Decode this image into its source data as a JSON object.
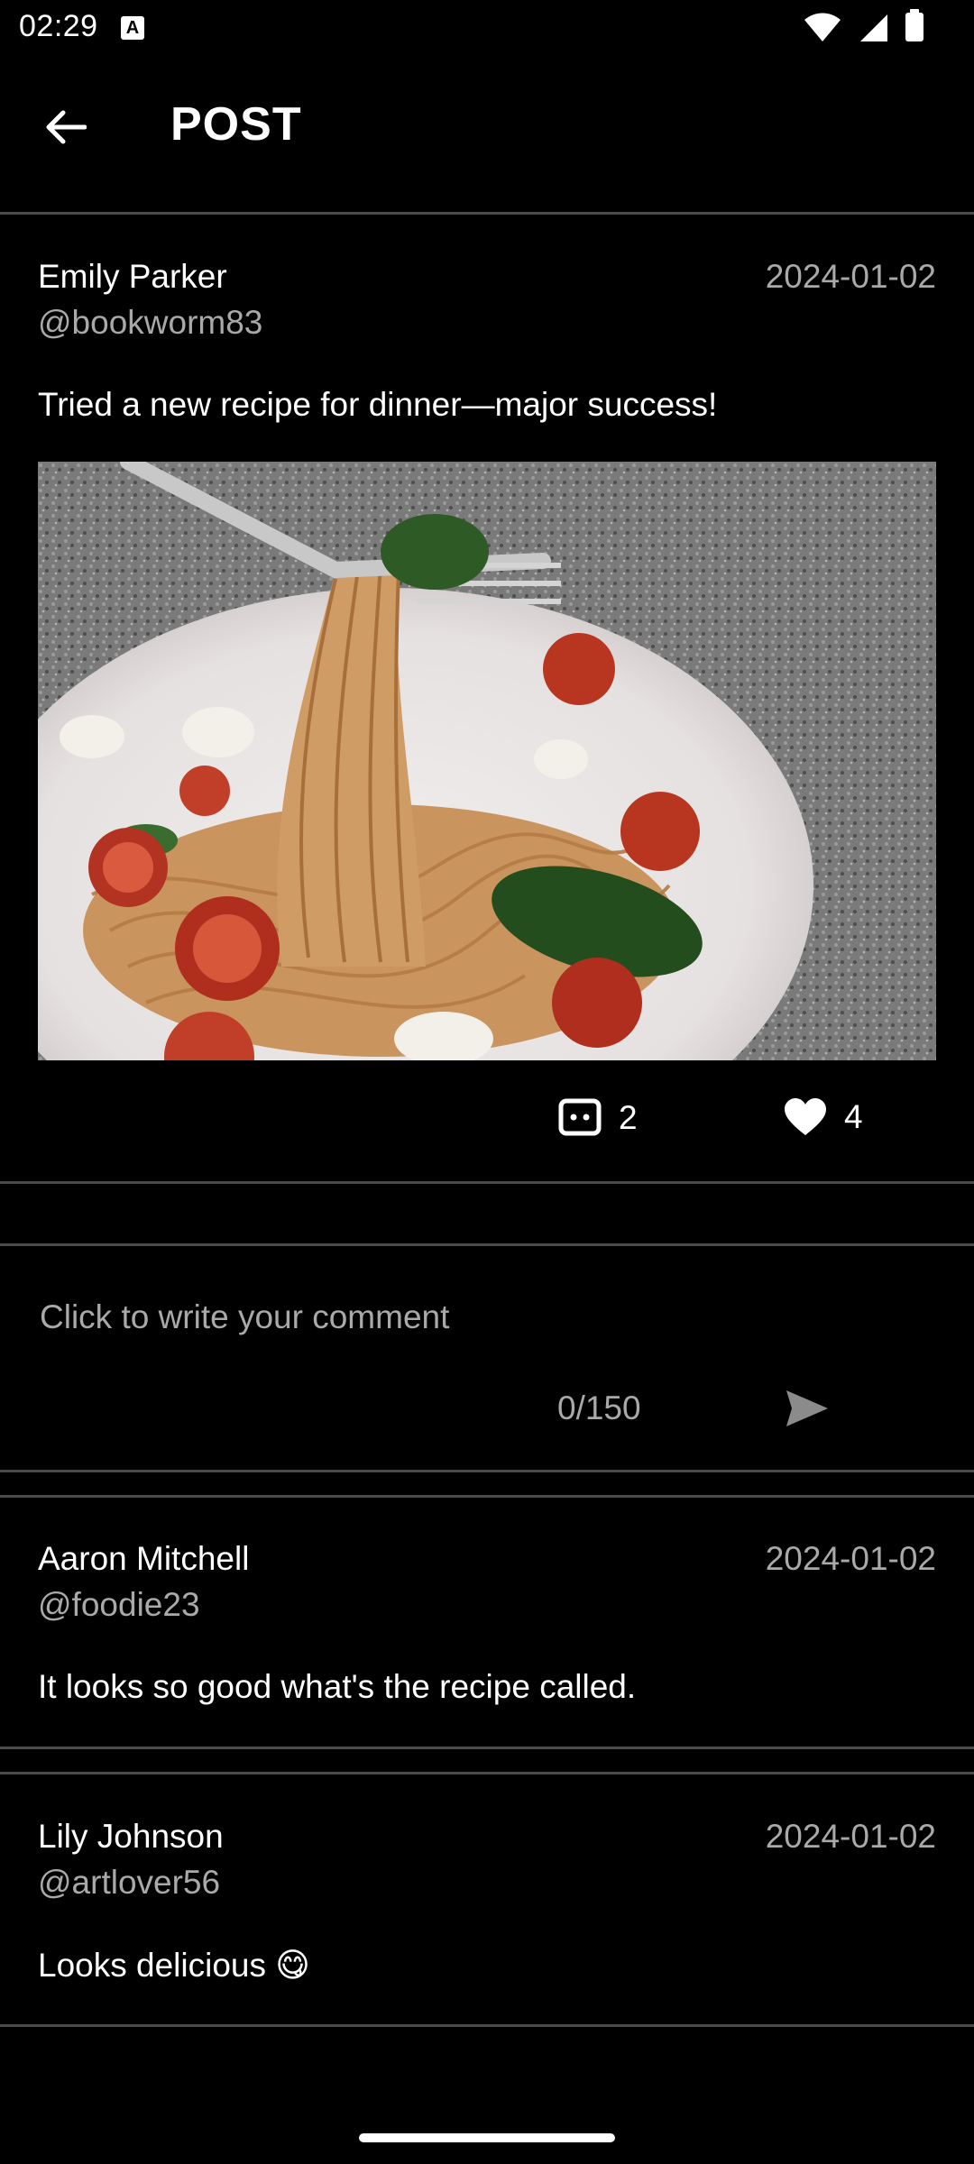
{
  "status_bar": {
    "time": "02:29",
    "notification_icon": "text-a-icon",
    "icons": [
      "wifi-icon",
      "cellular-signal-icon",
      "battery-icon"
    ]
  },
  "app_bar": {
    "back_icon": "arrow-left-icon",
    "title": "POST"
  },
  "post": {
    "author_name": "Emily Parker",
    "author_handle": "@bookworm83",
    "date": "2024-01-02",
    "text": "Tried a new recipe for dinner—major success!",
    "image": "spaghetti-with-tomatoes-and-basil-photo",
    "comment_icon": "comment-icon",
    "comments_count": "2",
    "like_icon": "heart-icon",
    "likes_count": "4"
  },
  "comment_box": {
    "placeholder": "Click to write your comment",
    "value": "",
    "counter": "0/150",
    "send_icon": "send-icon"
  },
  "comments": [
    {
      "author_name": "Aaron Mitchell",
      "author_handle": "@foodie23",
      "date": "2024-01-02",
      "text": "It looks so good what's the recipe called."
    },
    {
      "author_name": "Lily Johnson",
      "author_handle": "@artlover56",
      "date": "2024-01-02",
      "text": "Looks delicious 😋"
    }
  ],
  "colors": {
    "background": "#000000",
    "primary_text": "#ffffff",
    "secondary_text": "#a9a9a9",
    "divider": "#4b4b4b"
  }
}
